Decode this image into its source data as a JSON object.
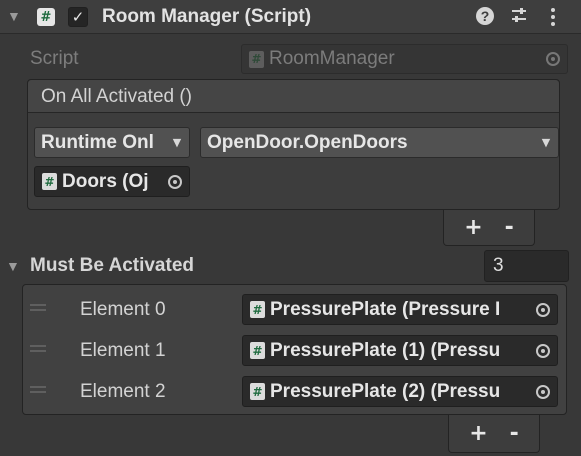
{
  "component": {
    "title": "Room Manager (Script)",
    "enabled": true,
    "icons": {
      "help": "help-icon",
      "presets": "presets-icon",
      "menu": "kebab-menu-icon"
    }
  },
  "script_field": {
    "label": "Script",
    "value": "RoomManager"
  },
  "event": {
    "header": "On All Activated ()",
    "call_state": "Runtime Onl",
    "function": "OpenDoor.OpenDoors",
    "target_object": "Doors (Oj",
    "add_label": "+",
    "remove_label": "-"
  },
  "list": {
    "label": "Must Be Activated",
    "count": "3",
    "elements": [
      {
        "label": "Element 0",
        "value": "PressurePlate (Pressure I"
      },
      {
        "label": "Element 1",
        "value": "PressurePlate (1) (Pressu"
      },
      {
        "label": "Element 2",
        "value": "PressurePlate (2) (Pressu"
      }
    ],
    "add_label": "+",
    "remove_label": "-"
  },
  "colors": {
    "background": "#383838",
    "script_icon_green": "#1f6b3f",
    "field": "#2a2a2a"
  }
}
